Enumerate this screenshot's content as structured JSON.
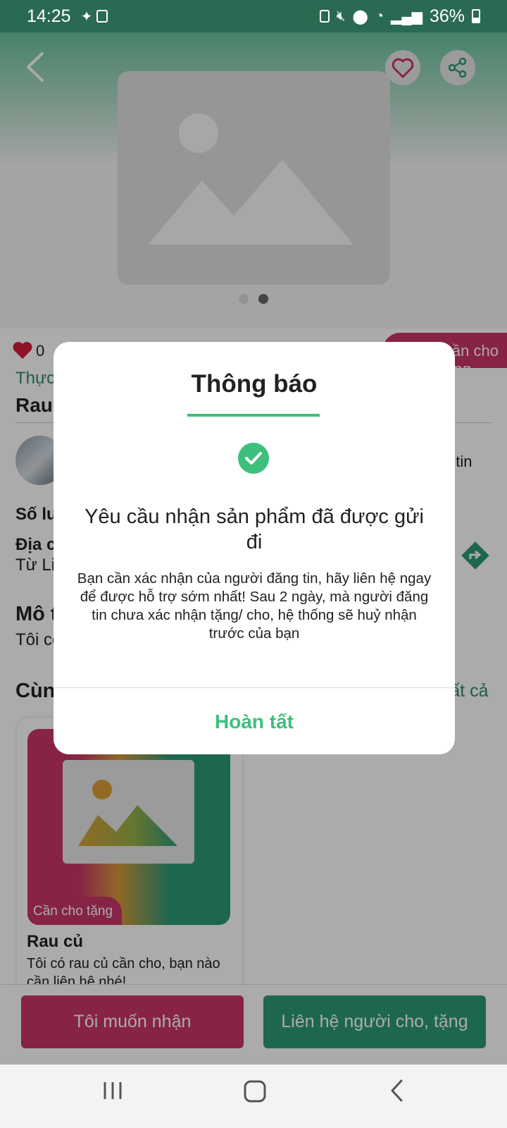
{
  "status_bar": {
    "time": "14:25",
    "battery": "36%"
  },
  "product": {
    "like_count": "0",
    "tag_right": "Cần cho tặng",
    "category": "Thực phẩm",
    "title": "Rau củ",
    "report": "Báo tin",
    "quantity_label": "Số lượng",
    "address_label": "Địa chỉ",
    "address_value": "Từ Liêm",
    "desc_label": "Mô tả",
    "desc_value": "Tôi có rau củ cần cho"
  },
  "related": {
    "heading": "Cùng danh mục",
    "see_all": "Xem tất cả",
    "card": {
      "tag": "Cần cho tặng",
      "title": "Rau củ",
      "desc": "Tôi có rau củ cần cho, bạn nào cần liên hệ nhé!"
    }
  },
  "actions": {
    "receive": "Tôi muốn nhận",
    "contact": "Liên hệ người cho, tặng"
  },
  "dialog": {
    "title": "Thông báo",
    "heading": "Yêu cầu nhận sản phẩm đã được gửi đi",
    "body": "Bạn cần xác nhận của người đăng tin, hãy liên hệ ngay để được hỗ trợ sớm nhất! Sau 2 ngày, mà người đăng tin chưa xác nhận tặng/ cho, hệ thống sẽ huỷ nhận trước của bạn",
    "button": "Hoàn tất"
  },
  "colors": {
    "primary_green": "#2e9a77",
    "accent_green": "#3cc07c",
    "accent_red": "#c9356a"
  },
  "icons": [
    "back-icon",
    "heart-icon",
    "share-icon",
    "check-icon",
    "direction-icon",
    "recent-apps-icon",
    "home-icon",
    "nav-back-icon"
  ]
}
